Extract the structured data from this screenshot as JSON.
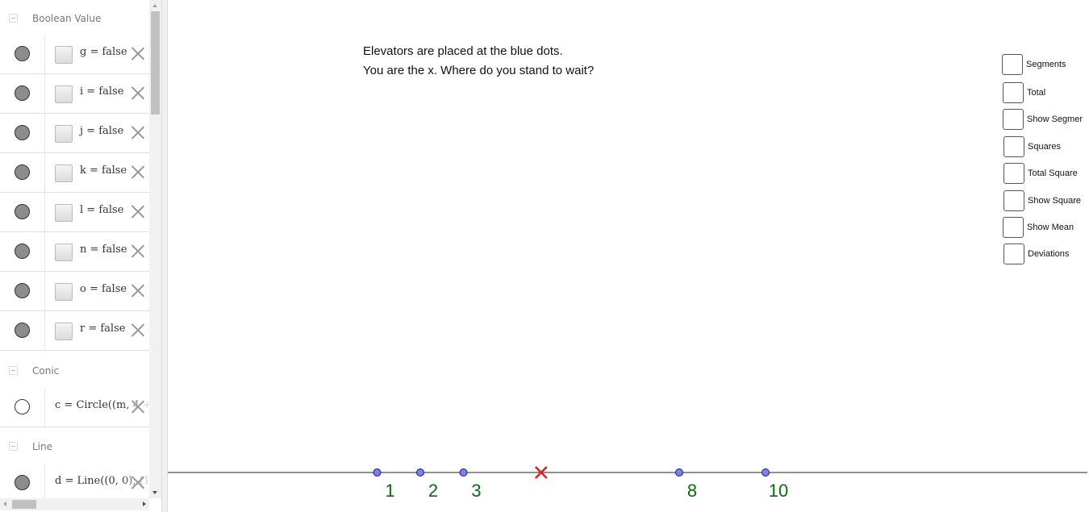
{
  "algebra": {
    "groups": [
      {
        "label": "Boolean Value",
        "rows": [
          {
            "text": "g = false"
          },
          {
            "text": "i = false"
          },
          {
            "text": "j = false"
          },
          {
            "text": "k = false"
          },
          {
            "text": "l = false"
          },
          {
            "text": "n = false"
          },
          {
            "text": "o = false"
          },
          {
            "text": "r = false"
          }
        ]
      },
      {
        "label": "Conic",
        "rows": [
          {
            "text": "c = Circle((m, 4 +"
          }
        ]
      },
      {
        "label": "Line",
        "rows": [
          {
            "text": "d = Line((0, 0), (1,"
          }
        ]
      }
    ]
  },
  "graphics": {
    "prompt": {
      "line1": "Elevators are placed at the blue dots.",
      "line2": "You are the x. Where do you stand to wait?"
    },
    "checkboxes": [
      {
        "label": "Segments"
      },
      {
        "label": "Total"
      },
      {
        "label": "Show Segmer"
      },
      {
        "label": "Squares"
      },
      {
        "label": "Total Square"
      },
      {
        "label": "Show Square"
      },
      {
        "label": "Show Mean"
      },
      {
        "label": "Deviations"
      }
    ],
    "number_line": {
      "elevator_positions": [
        1,
        2,
        3,
        8,
        10
      ],
      "labels": [
        "1",
        "2",
        "3",
        "8",
        "10"
      ],
      "marker_x": 4.8,
      "dot_color": "#7b80f0",
      "label_color": "#0a6b0a",
      "marker_color": "#e0201a"
    }
  }
}
